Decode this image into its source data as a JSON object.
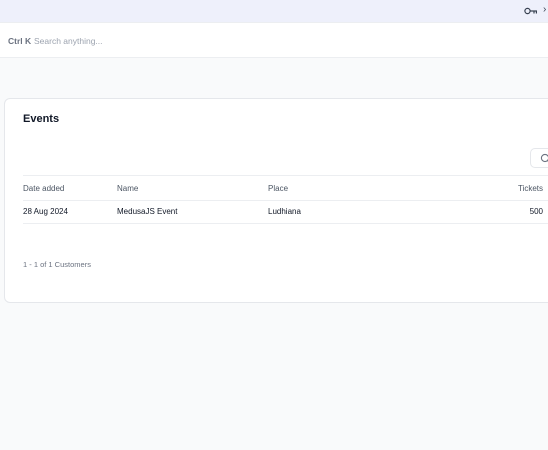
{
  "topbar": {
    "key_icon": "key-icon",
    "extra": "›"
  },
  "search": {
    "shortcut": "Ctrl K",
    "placeholder": "Search anything..."
  },
  "events": {
    "title": "Events",
    "search_icon": "search-icon",
    "columns": [
      "Date added",
      "Name",
      "Place",
      "Tickets"
    ],
    "rows": [
      {
        "date": "28 Aug 2024",
        "name": "MedusaJS Event",
        "place": "Ludhiana",
        "tickets": "500"
      }
    ],
    "footer": "1 - 1 of 1 Customers"
  }
}
